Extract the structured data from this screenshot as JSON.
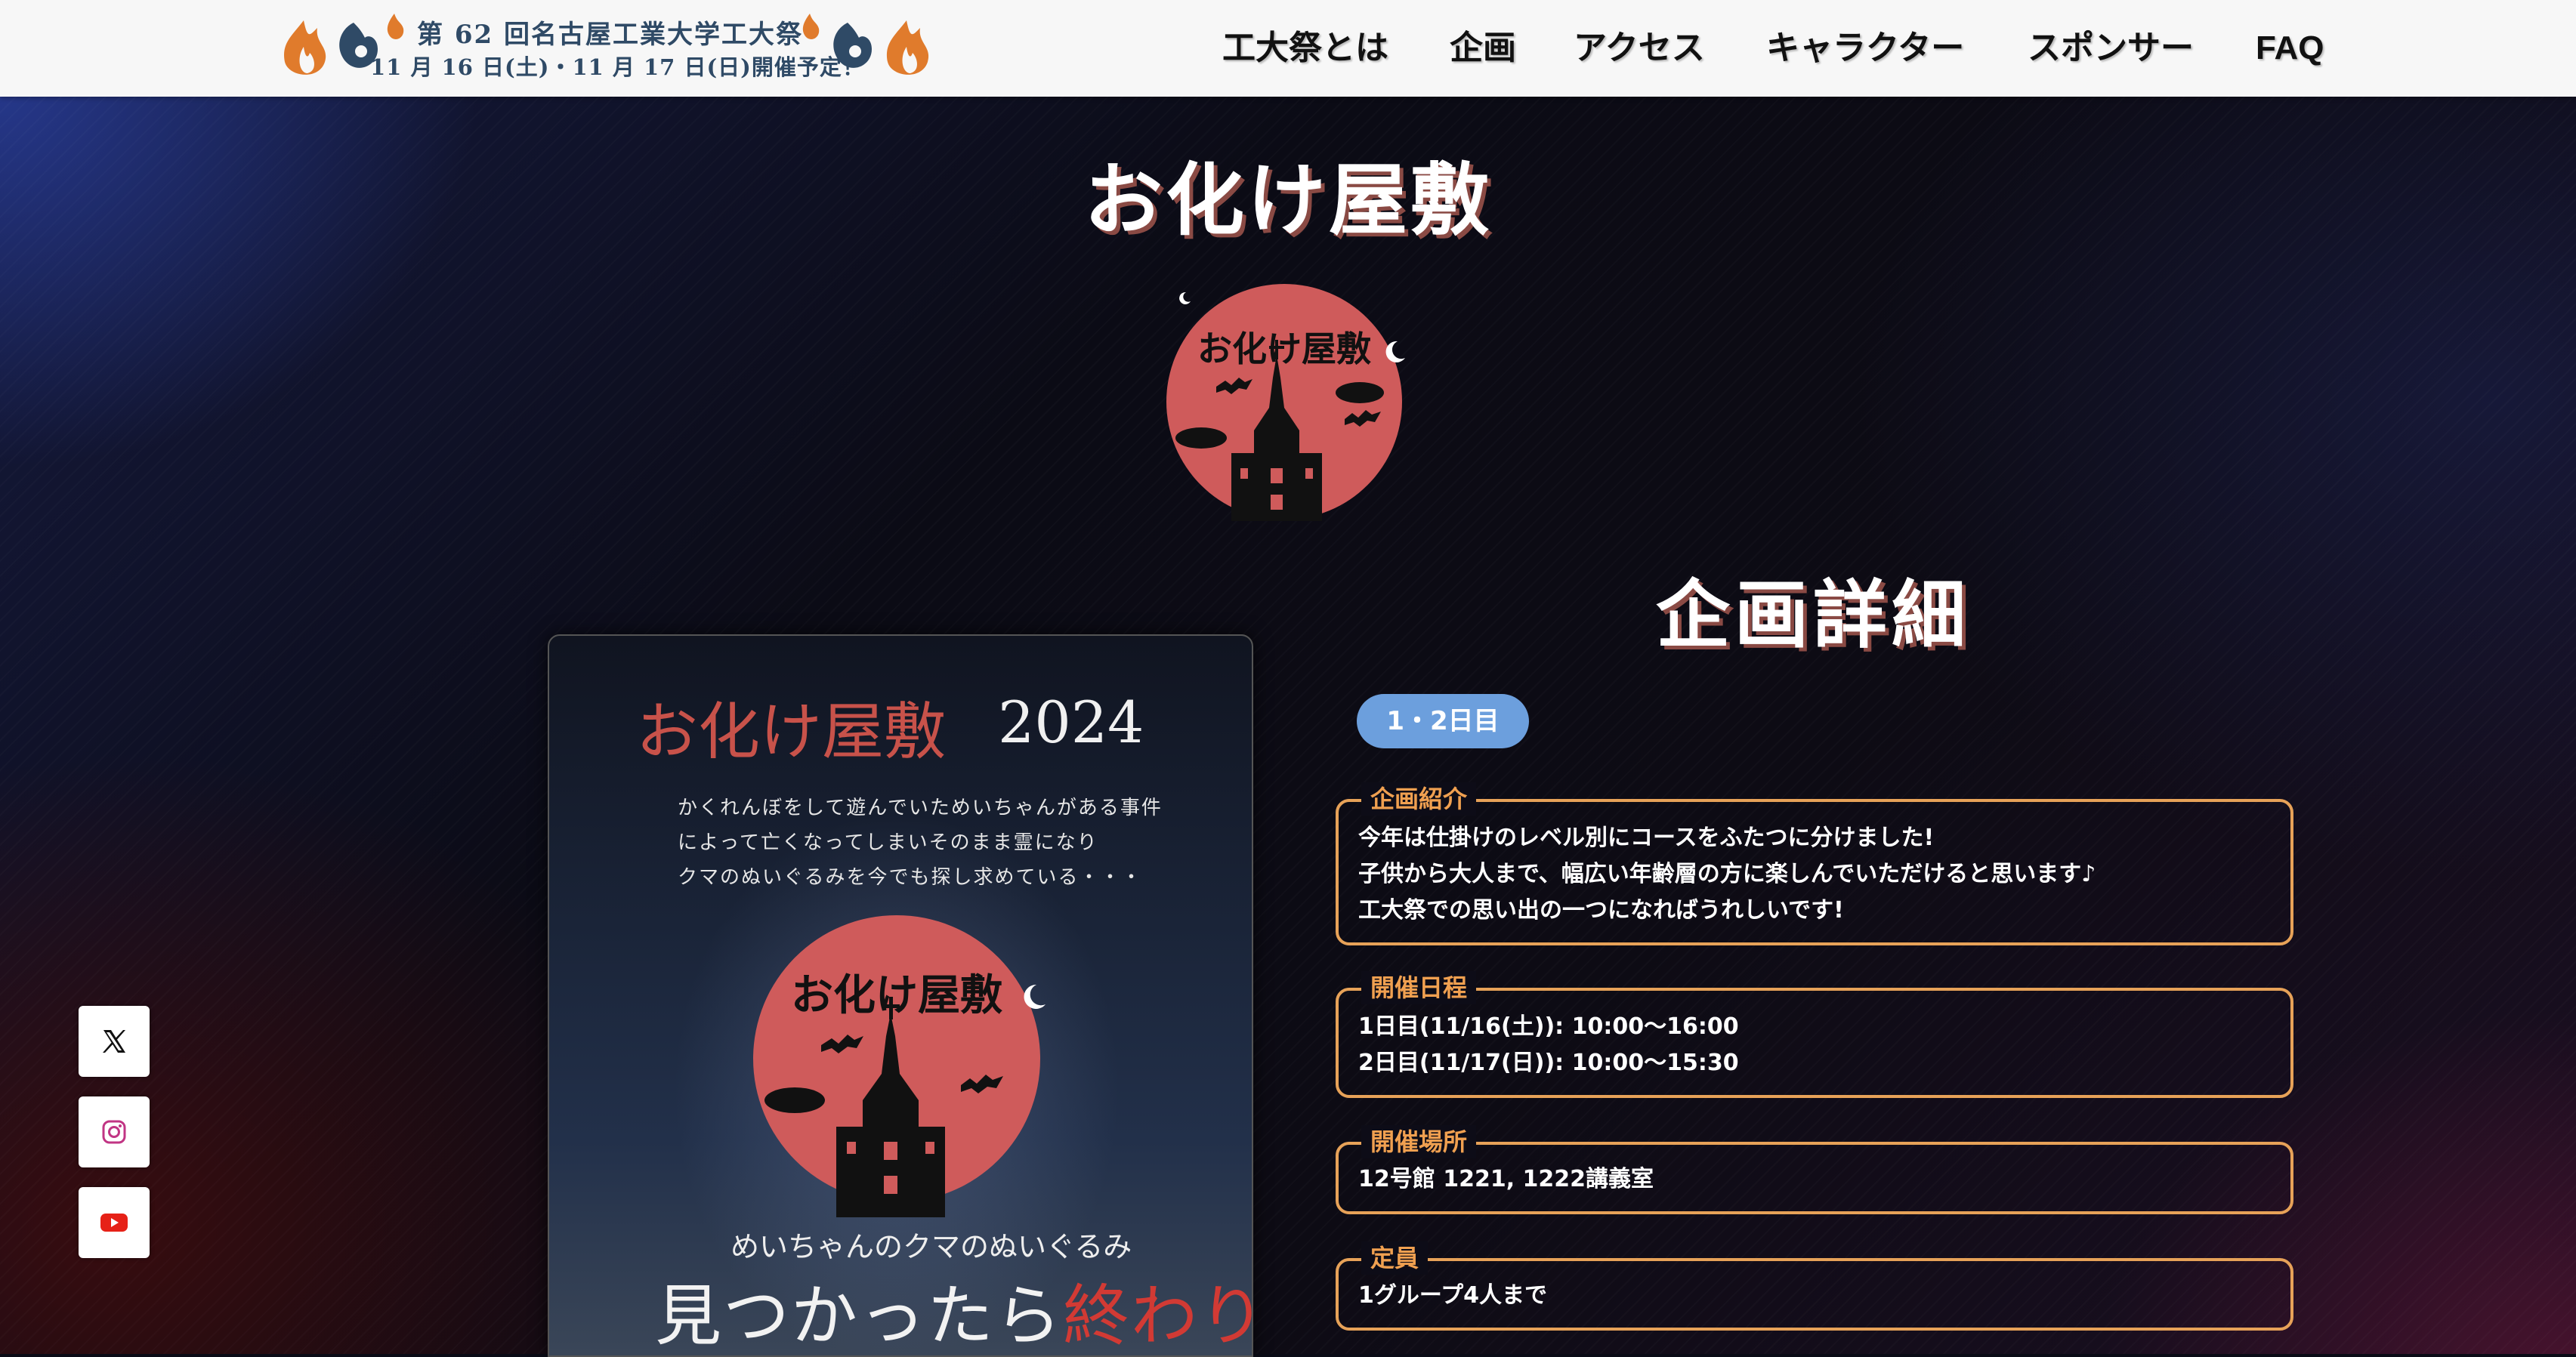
{
  "header": {
    "logo": {
      "line1": "第 62 回名古屋工業大学工大祭",
      "line2": "11 月 16 日(土)・11 月 17 日(日)開催予定！"
    },
    "nav": [
      "工大祭とは",
      "企画",
      "アクセス",
      "キャラクター",
      "スポンサー",
      "FAQ"
    ]
  },
  "page": {
    "title": "お化け屋敷",
    "emblem_text": "お化け屋敷"
  },
  "poster": {
    "title": "お化け屋敷",
    "year": "2024",
    "story": [
      "かくれんぼをして遊んでいためいちゃんがある事件",
      "によって亡くなってしまいそのまま霊になり",
      "クマのぬいぐるみを今でも探し求めている・・・"
    ],
    "emblem_text": "お化け屋敷",
    "sub": "めいちゃんのクマのぬいぐるみ",
    "tag_normal": "見つかったら",
    "tag_red": "終わり",
    "tag_end": ",,,"
  },
  "details": {
    "heading": "企画詳細",
    "day_tag": "1・2日目",
    "sections": [
      {
        "label": "企画紹介",
        "lines": [
          "今年は仕掛けのレベル別にコースをふたつに分けました!",
          "子供から大人まで、幅広い年齢層の方に楽しんでいただけると思います♪",
          "工大祭での思い出の一つになればうれしいです!"
        ]
      },
      {
        "label": "開催日程",
        "lines": [
          "1日目(11/16(土)): 10:00〜16:00",
          "2日目(11/17(日)): 10:00〜15:30"
        ]
      },
      {
        "label": "開催場所",
        "lines": [
          "12号館 1221, 1222講義室"
        ]
      },
      {
        "label": "定員",
        "lines": [
          "1グループ4人まで"
        ]
      }
    ]
  },
  "social": {
    "icons": [
      "x-icon",
      "instagram-icon",
      "youtube-icon"
    ]
  },
  "colors": {
    "accent_orange": "#e7a258",
    "title_shadow": "#8a4a44",
    "day_tag": "#6c9fdd",
    "emblem_red": "#cf5b5b",
    "logo_navy": "#2f4a66"
  }
}
